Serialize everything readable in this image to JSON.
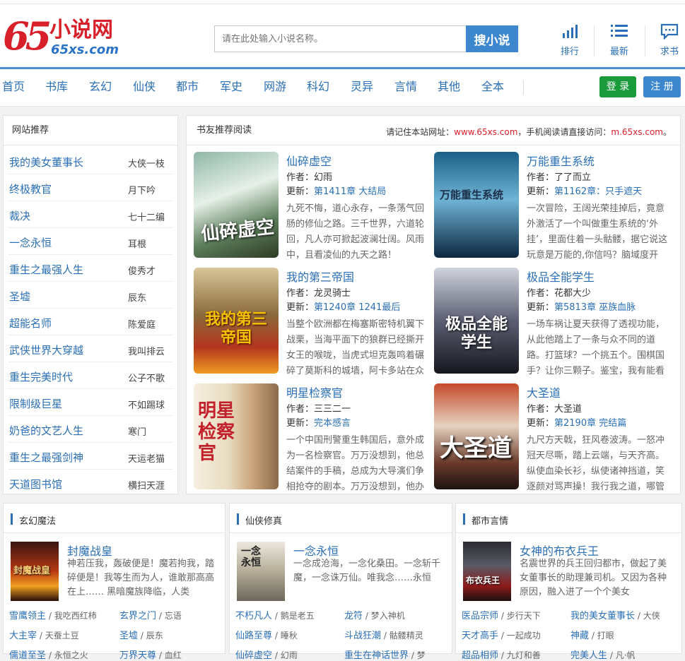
{
  "header": {
    "logo_num": "65",
    "logo_cn": "小说网",
    "logo_en": "65xs.com",
    "search_placeholder": "请在此处输入小说名称。",
    "search_button": "搜小说",
    "quick": [
      {
        "label": "排行",
        "icon": "bar-chart-icon"
      },
      {
        "label": "最新",
        "icon": "list-icon"
      },
      {
        "label": "求书",
        "icon": "message-icon"
      }
    ]
  },
  "nav": {
    "items": [
      "首页",
      "书库",
      "玄幻",
      "仙侠",
      "都市",
      "军史",
      "网游",
      "科幻",
      "灵异",
      "言情",
      "其他",
      "全本"
    ],
    "login": "登 录",
    "register": "注 册"
  },
  "left": {
    "heading": "网站推荐",
    "rows": [
      {
        "title": "我的美女董事长",
        "author": "大侠一枝"
      },
      {
        "title": "终极教官",
        "author": "月下吟"
      },
      {
        "title": "裁决",
        "author": "七十二编"
      },
      {
        "title": "一念永恒",
        "author": "耳根"
      },
      {
        "title": "重生之最强人生",
        "author": "俊秀才"
      },
      {
        "title": "圣墟",
        "author": "辰东"
      },
      {
        "title": "超能名师",
        "author": "陈爱庭"
      },
      {
        "title": "武侠世界大穿越",
        "author": "我叫排云"
      },
      {
        "title": "重生完美时代",
        "author": "公子不歌"
      },
      {
        "title": "限制级巨星",
        "author": "不如踢球"
      },
      {
        "title": "奶爸的文艺人生",
        "author": "寒门"
      },
      {
        "title": "重生之最强剑神",
        "author": "天运老猫"
      },
      {
        "title": "天道图书馆",
        "author": "横扫天涯"
      }
    ]
  },
  "main": {
    "heading": "书友推荐阅读",
    "notice_a": "请记住本站网址：",
    "notice_url": "www.65xs.com",
    "notice_b": "，手机阅读请直接访问：",
    "notice_murl": "m.65xs.com",
    "notice_c": "。",
    "author_label": "作者：",
    "update_label": "更新：",
    "books": [
      {
        "title": "仙碎虚空",
        "author": "幻雨",
        "update": "第1411章 大结局",
        "desc": "九死不悔，道心永存，一条荡气回肠的修仙之路。三千世界，六道轮回，凡人亦可掀起波澜壮阔。风雨中，且看凌仙的九天之路！",
        "cover_text": "仙碎虚空"
      },
      {
        "title": "万能重生系统",
        "author": "了了而立",
        "update": "第1162章：只手遮天",
        "desc": "一次冒险，王阔光荣挂掉后，竟意外激活了一个叫做重生系统的‘外挂’，里面住着一头骷髅，据它说这玩意是万能的,你信吗？脑域度开",
        "cover_text": "万能重生系统"
      },
      {
        "title": "我的第三帝国",
        "author": "龙灵骑士",
        "update": "第1240章 1241最后",
        "desc": "当整个欧洲都在梅塞斯密特机翼下战栗，当海平面下的狼群已经撕开女王的喉咙，当虎式坦克轰鸣着碾碎了莫斯科的城墙，阿卡多站在众",
        "cover_text": "我的第三帝国"
      },
      {
        "title": "极品全能学生",
        "author": "花都大少",
        "update": "第5813章 巫族血脉",
        "desc": "一场车祸让夏天获得了透视功能，从此他踏上了一条与众不同的道路。打篮球？一个挑五个。围棋国手？让你三颗子。鉴宝，我有能看",
        "cover_text": "极品全能学生"
      },
      {
        "title": "明星检察官",
        "author": "三三二一",
        "update": "完本感言",
        "desc": "一个中国刑警重生韩国后，意外成为一名检察官。万万没想到，他总结案件的手稿，总成为大导演们争相抢夺的剧本。万万没想到，他办",
        "cover_text": "明星检察官"
      },
      {
        "title": "大圣道",
        "author": "大圣道",
        "update": "第2190章 完结篇",
        "desc": "九尺方天戟，狂风卷波涛。一怒冲冠天尽嘶，踏上云端，与天齐高。纵使血染长衫，纵使诸神挡道，笑逐颜对骂声操！我行我之道，哪管",
        "cover_text": "大圣道"
      }
    ]
  },
  "categories": [
    {
      "name": "玄幻魔法",
      "featured": {
        "title": "封魔战皇",
        "desc": "神若压我，轰破便是！魔若拘我，踏碎便是！我等生而为人，谁敢那高高在上…… 黑暗魔族降临，人类",
        "cover_text": "封魔战皇"
      },
      "links": [
        {
          "name": "雪鹰领主",
          "author": "我吃西红柿"
        },
        {
          "name": "玄界之门",
          "author": "忘语"
        },
        {
          "name": "大主宰",
          "author": "天蚕土豆"
        },
        {
          "name": "圣墟",
          "author": "辰东"
        },
        {
          "name": "儒道至圣",
          "author": "永恒之火"
        },
        {
          "name": "万界天尊",
          "author": "血红"
        }
      ]
    },
    {
      "name": "仙侠修真",
      "featured": {
        "title": "一念永恒",
        "desc": "一念成沧海，一念化桑田。一念斩千魔，一念诛万仙。唯我念……永恒",
        "cover_text": "一念永恒"
      },
      "links": [
        {
          "name": "不朽凡人",
          "author": "鹅是老五"
        },
        {
          "name": "龙符",
          "author": "梦入神机"
        },
        {
          "name": "仙路至尊",
          "author": "睡秋"
        },
        {
          "name": "斗战狂潮",
          "author": "骷髅精灵"
        },
        {
          "name": "仙碎虚空",
          "author": "幻雨"
        },
        {
          "name": "重生在神话世界",
          "author": "梦"
        }
      ]
    },
    {
      "name": "都市言情",
      "featured": {
        "title": "女神的布衣兵王",
        "desc": "名震世界的兵王回归都市，做起了美女董事长的助理兼司机。又因为各种原因，融入进了一个个美女",
        "cover_text": "布衣兵王"
      },
      "links": [
        {
          "name": "医品宗师",
          "author": "步行天下"
        },
        {
          "name": "我的美女董事长",
          "author": "大侠"
        },
        {
          "name": "天才高手",
          "author": "一起成功"
        },
        {
          "name": "神藏",
          "author": "打眼"
        },
        {
          "name": "超品相师",
          "author": "九灯和善"
        },
        {
          "name": "完美人生",
          "author": "凡·帆"
        }
      ]
    }
  ],
  "colors": {
    "brand_red": "#d8202a",
    "link_blue": "#2a6fb5",
    "accent_blue": "#3d87cf",
    "login_green": "#1a9a3a"
  }
}
